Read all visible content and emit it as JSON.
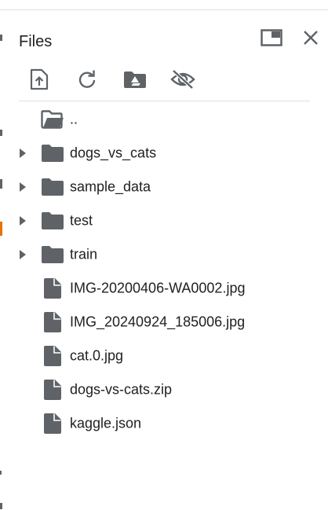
{
  "panel": {
    "title": "Files"
  },
  "header_buttons": [
    {
      "name": "open-in-tab-icon",
      "label": "Open in new tab"
    },
    {
      "name": "close-icon",
      "label": "Close"
    }
  ],
  "toolbar": {
    "buttons": [
      {
        "name": "upload-icon"
      },
      {
        "name": "refresh-icon"
      },
      {
        "name": "mount-drive-icon"
      },
      {
        "name": "hide-files-icon"
      }
    ]
  },
  "tree": {
    "parent_label": "..",
    "folders": [
      {
        "label": "dogs_vs_cats"
      },
      {
        "label": "sample_data"
      },
      {
        "label": "test"
      },
      {
        "label": "train"
      }
    ],
    "files": [
      {
        "label": "IMG-20200406-WA0002.jpg"
      },
      {
        "label": "IMG_20240924_185006.jpg"
      },
      {
        "label": "cat.0.jpg"
      },
      {
        "label": "dogs-vs-cats.zip"
      },
      {
        "label": "kaggle.json"
      }
    ]
  },
  "colors": {
    "icon": "#5f6368",
    "text": "#202124",
    "divider": "#e0e0e0",
    "accent": "#e37400"
  }
}
